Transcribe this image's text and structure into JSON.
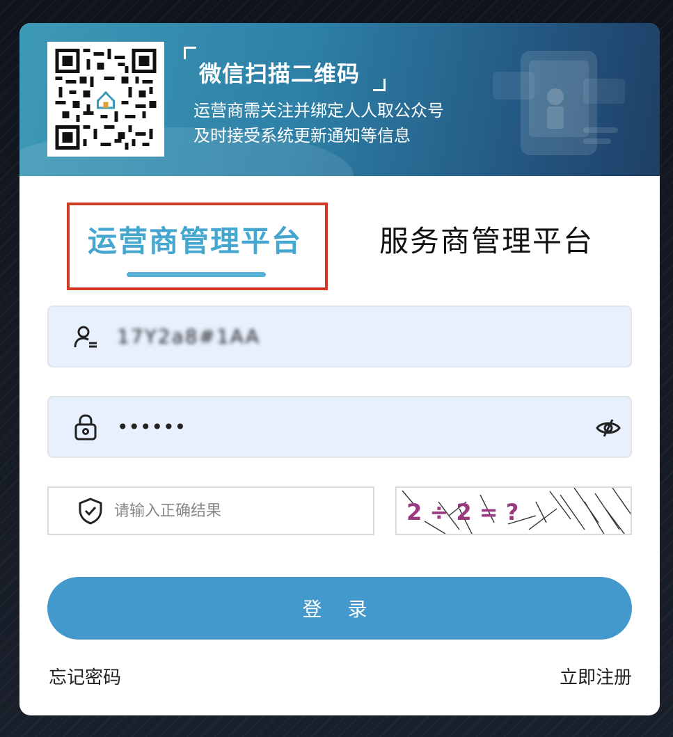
{
  "banner": {
    "title": "微信扫描二维码",
    "desc_line1": "运营商需关注并绑定人人取公众号",
    "desc_line2": "及时接受系统更新通知等信息"
  },
  "tabs": [
    {
      "label": "运营商管理平台",
      "active": true
    },
    {
      "label": "服务商管理平台",
      "active": false
    }
  ],
  "form": {
    "username_value": "17Y2a8#1AA",
    "password_mask": "••••••",
    "captcha_placeholder": "请输入正确结果",
    "captcha_text": "2 ÷ 2 = ?",
    "login_label": "登 录"
  },
  "links": {
    "forgot": "忘记密码",
    "register": "立即注册"
  },
  "colors": {
    "accent": "#45a6cf",
    "button": "#4499cc",
    "highlight": "#d13a25"
  }
}
